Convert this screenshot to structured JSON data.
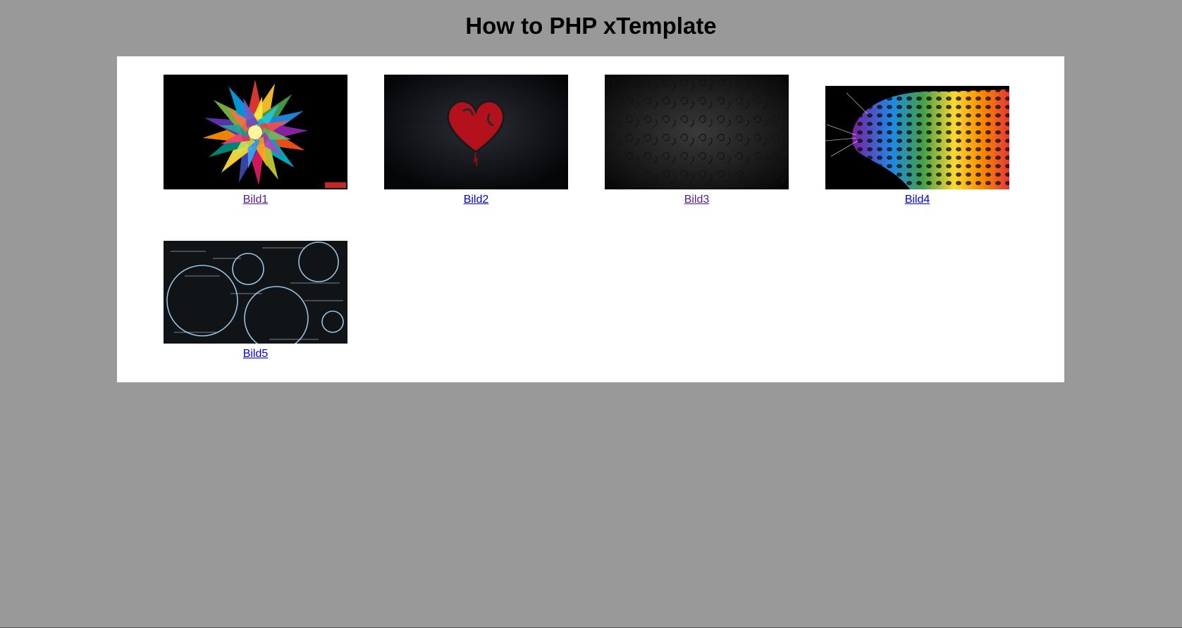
{
  "page": {
    "title": "How to PHP xTemplate",
    "background_color": "#999999",
    "panel_color": "#ffffff"
  },
  "gallery": {
    "items": [
      {
        "label": "Bild1",
        "link_state": "visited",
        "image_subject": "colorful-mandala-flower"
      },
      {
        "label": "Bild2",
        "link_state": "unvisited",
        "image_subject": "red-heart-on-dark"
      },
      {
        "label": "Bild3",
        "link_state": "visited",
        "image_subject": "dark-ornamental-pattern"
      },
      {
        "label": "Bild4",
        "link_state": "unvisited",
        "image_subject": "rainbow-leopard"
      },
      {
        "label": "Bild5",
        "link_state": "unvisited",
        "image_subject": "chalkboard-math-formulas"
      }
    ]
  },
  "colors": {
    "link_unvisited": "#0000ee",
    "link_visited": "#551a8b"
  }
}
